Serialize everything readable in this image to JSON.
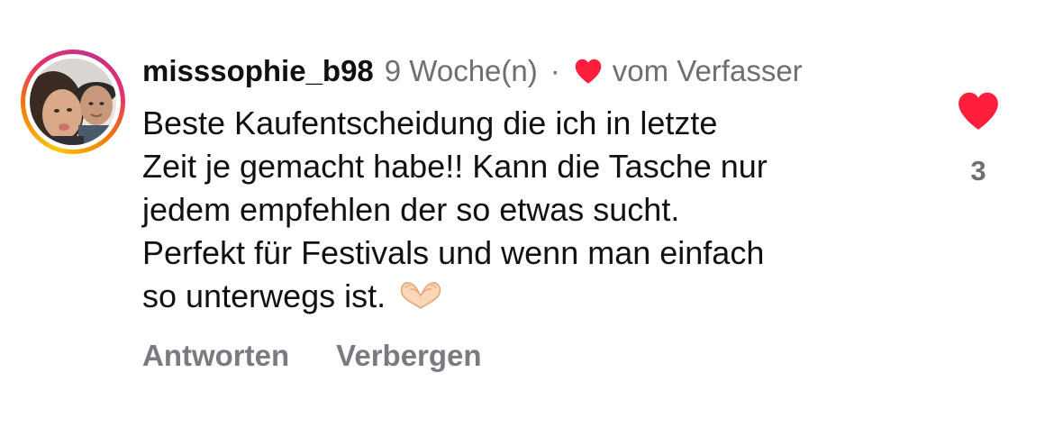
{
  "comment": {
    "username": "misssophie_b98",
    "time_ago": "9 Woche(n)",
    "separator": "·",
    "author_like_text": "vom Verfasser",
    "text_lines": [
      "Beste Kaufentscheidung die ich in letzte",
      "Zeit je gemacht habe!! Kann die Tasche nur",
      "jedem empfehlen der so etwas sucht.",
      "Perfekt für Festivals und wenn man einfach",
      "so unterwegs ist."
    ],
    "emoji": "heart-hands-emoji",
    "like_count": "3",
    "like_icon": "heart-icon",
    "liked": true
  },
  "actions": {
    "reply_label": "Antworten",
    "hide_label": "Verbergen"
  },
  "colors": {
    "heart": "#ff1f3d",
    "meta_text": "#6e6e73",
    "action_text": "#7a7a80",
    "primary_text": "#111111"
  }
}
